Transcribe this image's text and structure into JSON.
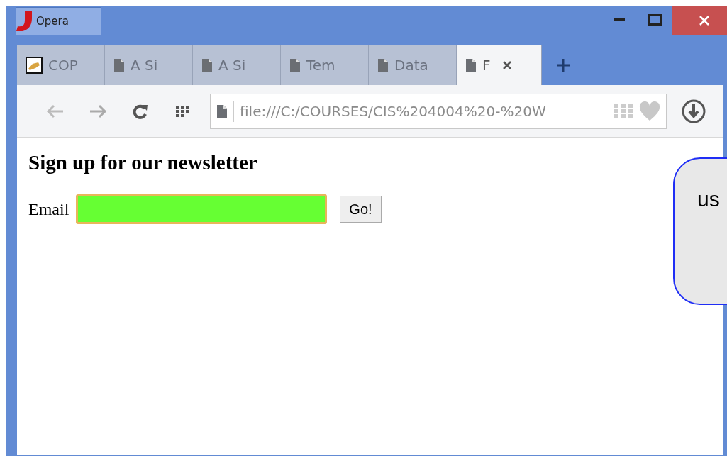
{
  "window": {
    "app_button": "Opera"
  },
  "tabs": [
    {
      "label": "COP",
      "selected": false,
      "kind": "image"
    },
    {
      "label": "A Si",
      "selected": false,
      "kind": "page"
    },
    {
      "label": "A Si",
      "selected": false,
      "kind": "page"
    },
    {
      "label": "Tem",
      "selected": false,
      "kind": "page"
    },
    {
      "label": "Data",
      "selected": false,
      "kind": "page"
    },
    {
      "label": "F",
      "selected": true,
      "kind": "page"
    }
  ],
  "address_bar": {
    "url": "file:///C:/COURSES/CIS%204004%20-%20W"
  },
  "page": {
    "heading": "Sign up for our newsletter",
    "email_label": "Email",
    "submit": "Go!"
  },
  "callout": {
    "text": "us"
  }
}
